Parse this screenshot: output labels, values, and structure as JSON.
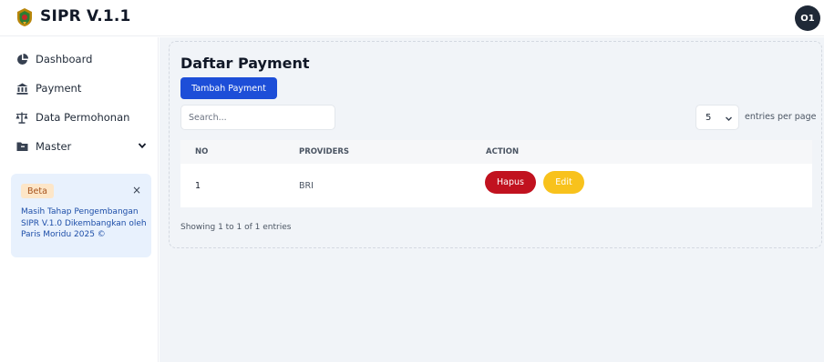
{
  "header": {
    "app_title": "SIPR V.1.1",
    "logo_icon": "emblem-logo",
    "avatar_initials": "O1"
  },
  "sidebar": {
    "items": [
      {
        "label": "Dashboard",
        "icon": "pie-chart-icon"
      },
      {
        "label": "Payment",
        "icon": "bank-icon"
      },
      {
        "label": "Data Permohonan",
        "icon": "scale-icon"
      },
      {
        "label": "Master",
        "icon": "folder-icon",
        "expandable": true
      }
    ],
    "beta": {
      "badge": "Beta",
      "close": "×",
      "message": "Masih Tahap Pengembangan SIPR V.1.0 Dikembangkan oleh Paris Moridu 2025 ©"
    }
  },
  "main": {
    "title": "Daftar Payment",
    "add_button": "Tambah Payment",
    "search_placeholder": "Search...",
    "entries_value": "5",
    "entries_label": "entries per page",
    "table": {
      "columns": [
        "NO",
        "PROVIDERS",
        "ACTION"
      ],
      "rows": [
        {
          "no": "1",
          "provider": "BRI",
          "actions": [
            "Hapus",
            "Edit"
          ]
        }
      ]
    },
    "showing_text": "Showing 1 to 1 of 1 entries"
  },
  "colors": {
    "primary": "#1d4ed8",
    "danger": "#c1121f",
    "warning": "#f8c21c",
    "background": "#f1f4f8",
    "beta_card": "#e8f1fd"
  }
}
